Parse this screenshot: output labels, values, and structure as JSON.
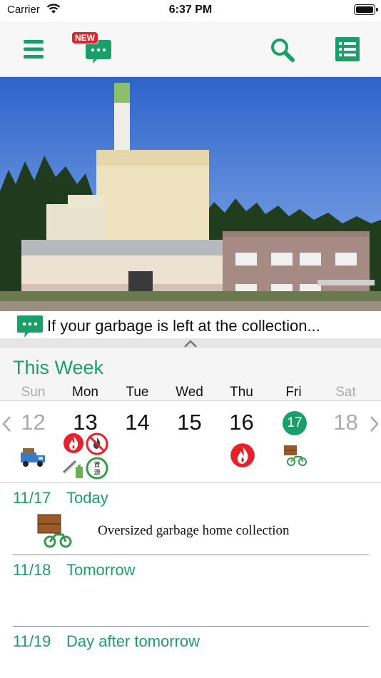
{
  "status_bar": {
    "carrier": "Carrier",
    "time": "6:37 PM"
  },
  "toolbar": {
    "new_badge": "NEW"
  },
  "notice": {
    "text": "If your garbage is left at the collection..."
  },
  "week": {
    "title": "This Week",
    "days_of_week": [
      "Sun",
      "Mon",
      "Tue",
      "Wed",
      "Thu",
      "Fri",
      "Sat"
    ],
    "dates": [
      "12",
      "13",
      "14",
      "15",
      "16",
      "17",
      "18"
    ],
    "today_index": 5,
    "icons_per_day": [
      [
        "truck-icon"
      ],
      [
        "burnable-icon",
        "no-burn-icon",
        "battery-icon",
        "recyclable-icon"
      ],
      [],
      [],
      [
        "burnable-icon"
      ],
      [
        "oversized-delivery-icon"
      ],
      []
    ]
  },
  "agenda": [
    {
      "date": "11/17",
      "label": "Today",
      "items": [
        {
          "icon": "oversized-delivery-icon",
          "text": "Oversized garbage home collection"
        }
      ]
    },
    {
      "date": "11/18",
      "label": "Tomorrow",
      "items": []
    },
    {
      "date": "11/19",
      "label": "Day after tomorrow",
      "items": []
    }
  ],
  "colors": {
    "accent": "#1a9e6a",
    "fire": "#e8202a",
    "muted": "#aaaaaa"
  },
  "icons": {
    "menu": "hamburger-icon",
    "news": "chat-bubble-icon",
    "search": "search-icon",
    "list": "list-icon"
  }
}
